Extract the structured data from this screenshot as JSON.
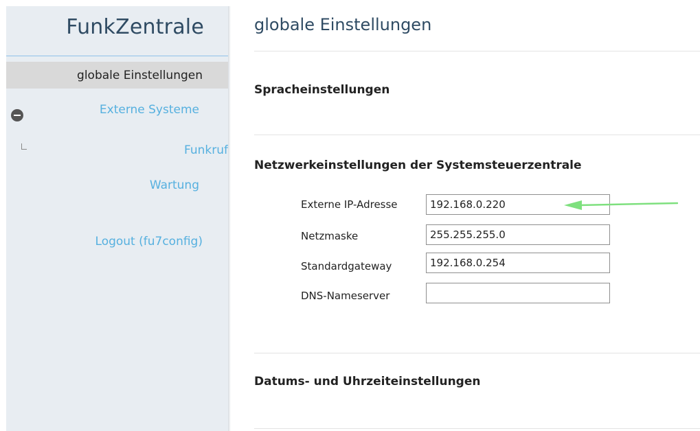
{
  "sidebar": {
    "brand": "FunkZentrale",
    "active_item": "globale Einstellungen",
    "items": [
      {
        "label": "Externe Systeme"
      },
      {
        "label": "Funkruf"
      },
      {
        "label": "Wartung"
      },
      {
        "label": "Logout (fu7config)"
      }
    ],
    "icons": [
      "minus-circle-icon",
      "tree-branch-icon"
    ]
  },
  "main": {
    "title": "globale Einstellungen",
    "sections": {
      "language": "Spracheinstellungen",
      "network": "Netzwerkeinstellungen der Systemsteuerzentrale",
      "datetime": "Datums- und Uhrzeiteinstellungen"
    },
    "fields": [
      {
        "label": "Externe IP-Adresse",
        "value": "192.168.0.220"
      },
      {
        "label": "Netzmaske",
        "value": "255.255.255.0"
      },
      {
        "label": "Standardgateway",
        "value": "192.168.0.254"
      },
      {
        "label": "DNS-Nameserver",
        "value": ""
      }
    ]
  },
  "colors": {
    "sidebar_bg": "#e8edf2",
    "brand": "#2f4b63",
    "link": "#56b0df",
    "active_bg": "#d9d9d9",
    "annotation_arrow": "#7ee07e"
  }
}
